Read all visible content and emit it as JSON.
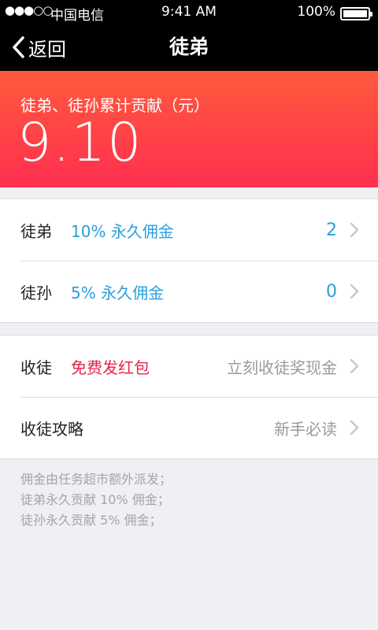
{
  "status_bar": {
    "signal": "●●●○○",
    "carrier": "中国电信",
    "time": "9:41 AM",
    "battery": "100%"
  },
  "nav": {
    "back_label": "返回",
    "title": "徒弟"
  },
  "hero": {
    "caption": "徒弟、徒孙累计贡献（元）",
    "amount": "9.10"
  },
  "disciples": [
    {
      "title": "徒弟",
      "desc": "10% 永久佣金",
      "count": "2"
    },
    {
      "title": "徒孙",
      "desc": "5% 永久佣金",
      "count": "0"
    }
  ],
  "recruit": [
    {
      "title": "收徒",
      "desc": "免费发红包",
      "value": "立刻收徒奖现金"
    },
    {
      "title": "收徒攻略",
      "desc": "",
      "value": "新手必读"
    }
  ],
  "notes": [
    "佣金由任务超市额外派发；",
    "徒弟永久贡献 10% 佣金；",
    "徒孙永久贡献 5% 佣金；"
  ],
  "colors": {
    "accent_blue": "#2a9fdc",
    "accent_red": "#e8254a",
    "hero_top": "#ff5a3c",
    "hero_bottom": "#ff2f50"
  }
}
